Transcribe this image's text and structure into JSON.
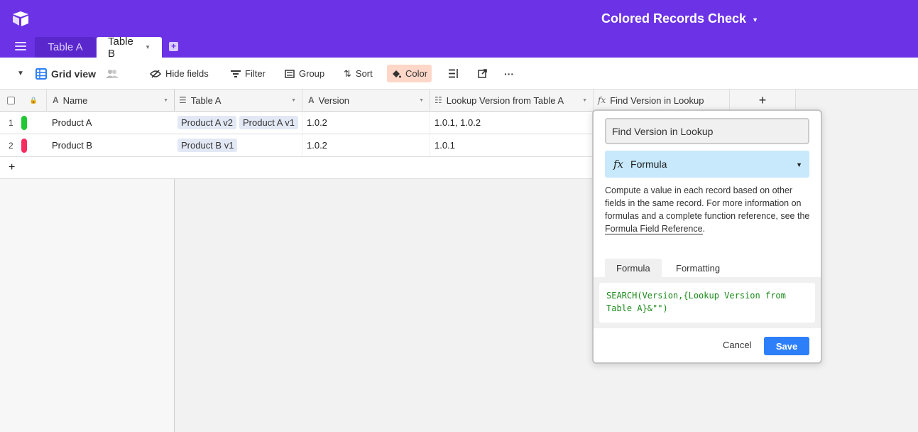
{
  "header": {
    "base_title": "Colored Records Check",
    "tabs": [
      {
        "label": "Table A"
      },
      {
        "label": "Table B"
      }
    ]
  },
  "toolbar": {
    "view_name": "Grid view",
    "hide_fields": "Hide fields",
    "filter": "Filter",
    "group": "Group",
    "sort": "Sort",
    "color": "Color"
  },
  "grid": {
    "columns": [
      {
        "label": "Name",
        "icon": "text-icon"
      },
      {
        "label": "Table A",
        "icon": "link-icon"
      },
      {
        "label": "Version",
        "icon": "text-icon"
      },
      {
        "label": "Lookup Version from Table A",
        "icon": "lookup-icon"
      },
      {
        "label": "Find Version in Lookup",
        "icon": "formula-icon"
      }
    ],
    "rows": [
      {
        "num": "1",
        "color": "#20c933",
        "name": "Product A",
        "links": [
          "Product A v2",
          "Product A v1"
        ],
        "version": "1.0.2",
        "lookup": "1.0.1, 1.0.2"
      },
      {
        "num": "2",
        "color": "#f82b60",
        "name": "Product B",
        "links": [
          "Product B v1"
        ],
        "version": "1.0.2",
        "lookup": "1.0.1"
      }
    ],
    "add_row": "+",
    "add_column": "+"
  },
  "popup": {
    "field_name": "Find Version in Lookup",
    "field_type": "Formula",
    "description_prefix": "Compute a value in each record based on other fields in the same record. For more information on formulas and a complete function reference, see the ",
    "description_link": "Formula Field Reference",
    "description_suffix": ".",
    "tab_formula": "Formula",
    "tab_formatting": "Formatting",
    "formula_line1": "SEARCH(Version,{Lookup Version from",
    "formula_line2": "Table A}&\"\")",
    "cancel": "Cancel",
    "save": "Save"
  },
  "colors": {
    "header_bg": "#6b32e6",
    "save_button": "#2d7ff9",
    "color_button_bg": "#ffd7c8",
    "field_type_bg": "#c7e9fb"
  }
}
